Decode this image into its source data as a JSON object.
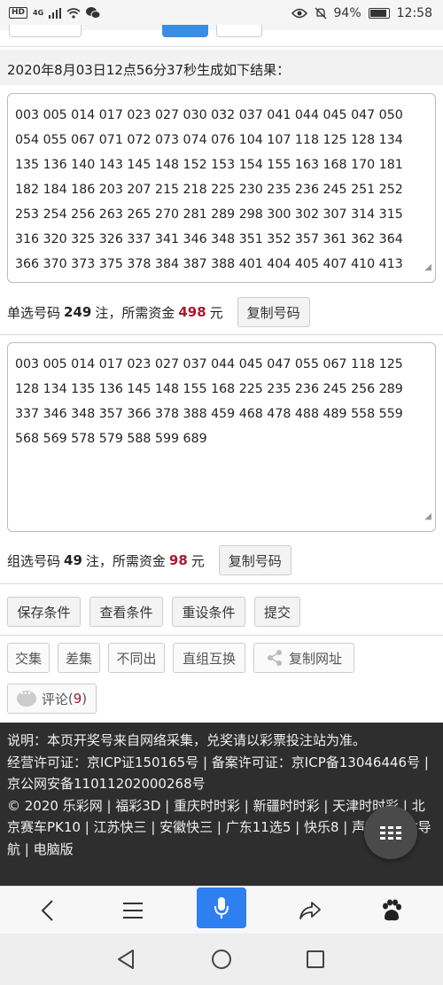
{
  "status_bar": {
    "network_hd": "HD",
    "network_gen": "4G",
    "battery": "94%",
    "battery_level": 0.94,
    "time": "12:58"
  },
  "result": {
    "header": "2020年8月03日12点56分37秒生成如下结果：",
    "single_numbers": "003 005 014 017 023 027 030 032 037 041 044 045 047 050 054 055 067 071 072 073 074 076 104 107 118 125 128 134 135 136 140 143 145 148 152 153 154 155 163 168 170 181 182 184 186 203 207 215 218 225 230 235 236 245 251 252 253 254 256 263 265 270 281 289 298 300 302 307 314 315 316 320 325 326 337 341 346 348 351 352 357 361 362 364 366 370 373 375 378 384 387 388 401 404 405 407 410 413",
    "group_numbers": "003 005 014 017 023 027 037 044 045 047 055 067 118 125 128 134 135 136 145 148 155 168 225 235 236 245 256 289 337 346 348 357 366 378 388 459 468 478 488 489 558 559 568 569 578 579 588 599 689"
  },
  "single_summary": {
    "prefix": "单选号码",
    "count": "249",
    "mid": "注，所需资金",
    "amount": "498",
    "suffix": "元",
    "copy_label": "复制号码"
  },
  "group_summary": {
    "prefix": "组选号码",
    "count": "49",
    "mid": "注，所需资金",
    "amount": "98",
    "suffix": "元",
    "copy_label": "复制号码"
  },
  "actions": {
    "save": "保存条件",
    "view": "查看条件",
    "reset": "重设条件",
    "submit": "提交",
    "intersect": "交集",
    "difference": "差集",
    "not_same": "不同出",
    "swap": "直组互换",
    "copy_url": "复制网址",
    "comment": "评论",
    "comment_count": "9"
  },
  "footer": {
    "line1": "说明：本页开奖号来自网络采集，兑奖请以彩票投注站为准。",
    "line2": "经营许可证：京ICP证150165号 | 备案许可证：京ICP备13046446号 | 京公网安备11011202000268号",
    "line3": "© 2020 乐彩网 | 福彩3D | 重庆时时彩 | 新疆时时彩 | 天津时时彩 | 北京赛车PK10 | 江苏快三 | 安徽快三 | 广东11选5 | 快乐8 | 声明 | 网站导航 | 电脑版"
  },
  "colors": {
    "accent_red": "#a8192e",
    "mic_blue": "#2e7ff0",
    "footer_bg": "#2e2e2e"
  }
}
